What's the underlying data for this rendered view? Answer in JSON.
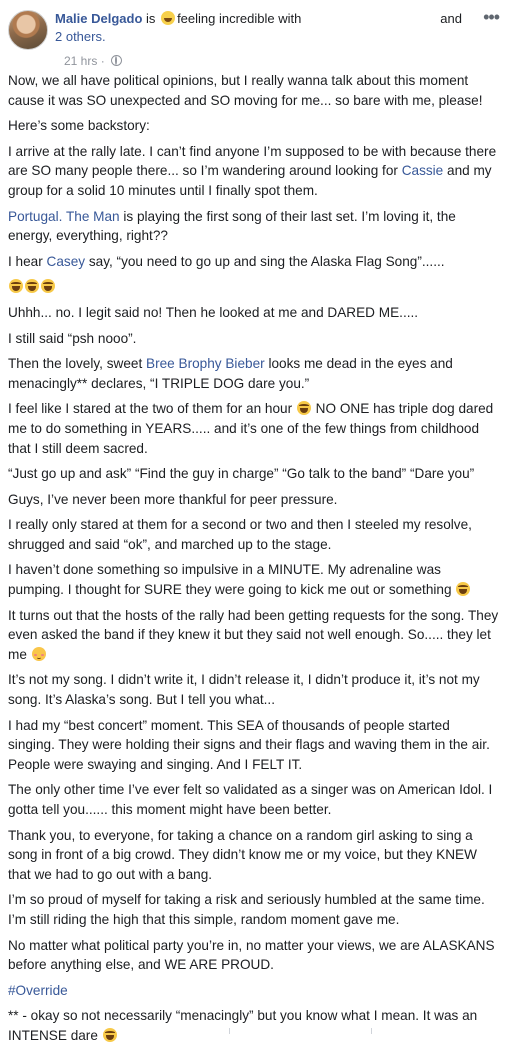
{
  "header": {
    "author": "Malie Delgado",
    "is": "is",
    "feeling": "feeling incredible with",
    "others": "2 others.",
    "and": "and",
    "menu": "•••",
    "timestamp": "21 hrs",
    "dot": "·"
  },
  "body": {
    "p1": "Now, we all have political opinions, but I really wanna talk about this moment cause it was SO unexpected and SO moving for me... so bare with me, please!",
    "p2": "Here’s some backstory:",
    "p3a": "I arrive at the rally late. I can’t find anyone I’m supposed to be with because there are SO many people there... so I’m wandering around looking for ",
    "p3link": "Cassie",
    "p3b": " and my group for a solid 10 minutes until I finally spot them.",
    "p4link1": "Portugal. The Man",
    "p4a": " is playing the first song of their last set. I’m loving it, the energy, everything, right??",
    "p5a": "I hear ",
    "p5link": "Casey",
    "p5b": " say, “you need to go up and sing the Alaska Flag Song”......",
    "p7": "Uhhh... no. I legit said no! Then he looked at me and DARED ME.....",
    "p8": "I still said “psh nooo”.",
    "p9a": "Then the lovely, sweet ",
    "p9link": "Bree Brophy Bieber",
    "p9b": " looks me dead in the eyes and menacingly** declares, “I TRIPLE DOG dare you.”",
    "p10a": "I feel like I stared at the two of them for an hour ",
    "p10b": " NO ONE has triple dog dared me to do something in YEARS..... and it’s one of the few things from childhood that I still deem sacred.",
    "p11": "“Just go up and ask” “Find the guy in charge” “Go talk to the band” “Dare you”",
    "p12": "Guys, I’ve never been more thankful for peer pressure.",
    "p13": "I really only stared at them for a second or two and then I steeled my resolve, shrugged and said “ok”, and marched up to the stage.",
    "p14": "I haven’t done something so impulsive in a MINUTE. My adrenaline was pumping. I thought for SURE they were going to kick me out or something ",
    "p15": "It turns out that the hosts of the rally had been getting requests for the song. They even asked the band if they knew it but they said not well enough. So..... they let me ",
    "p16": "It’s not my song. I didn’t write it, I didn’t release it, I didn’t produce it, it’s not my song. It’s Alaska’s song. But I tell you what...",
    "p17": "I had my “best concert” moment. This SEA of thousands of people started singing. They were holding their signs and their flags and waving them in the air. People were swaying and singing. And I FELT IT.",
    "p18": "The only other time I’ve ever felt so validated as a singer was on American Idol. I gotta tell you...... this moment might have been better.",
    "p19": "Thank you, to everyone, for taking a chance on a random girl asking to sing a song in front of a big crowd. They didn’t know me or my voice, but they KNEW that we had to go out with a bang.",
    "p20": "I’m so proud of myself for taking a risk and seriously humbled at the same time. I’m still riding the high that this simple, random moment gave me.",
    "p21": "No matter what political party you’re in, no matter your views, we are ALASKANS before anything else, and WE ARE PROUD.",
    "hashtag": "#Override",
    "p22": "** - okay so not necessarily “menacingly” but you know what I mean. It was an INTENSE dare "
  },
  "colors": {
    "link": "#385898",
    "text": "#1c1e21",
    "meta": "#90949c"
  }
}
